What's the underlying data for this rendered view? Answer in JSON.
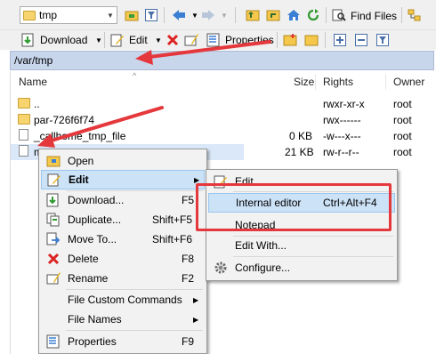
{
  "toolbar1": {
    "path_combo": "tmp",
    "find_files": "Find Files",
    "icons": [
      "folder-open-icon",
      "filter-icon",
      "back-icon",
      "forward-icon",
      "parent-dir-icon",
      "root-dir-icon",
      "home-icon",
      "refresh-icon",
      "find-icon",
      "tree-icon"
    ]
  },
  "toolbar2": {
    "download": "Download",
    "edit": "Edit",
    "properties": "Properties"
  },
  "pathbar": "/var/tmp",
  "columns": {
    "name": "Name",
    "size": "Size",
    "rights": "Rights",
    "owner": "Owner"
  },
  "files": [
    {
      "name": "..",
      "size": "",
      "rights": "rwxr-xr-x",
      "owner": "root"
    },
    {
      "name": "par-726f6f74",
      "size": "",
      "rights": "rwx------",
      "owner": "root"
    },
    {
      "name": "_callhome_tmp_file",
      "size": "0 KB",
      "rights": "-w---x---",
      "owner": "root"
    },
    {
      "name": "m",
      "size": "21 KB",
      "rights": "rw-r--r--",
      "owner": "root"
    }
  ],
  "context_menu": {
    "open": "Open",
    "edit": "Edit",
    "download": "Download...",
    "download_sc": "F5",
    "duplicate": "Duplicate...",
    "duplicate_sc": "Shift+F5",
    "move": "Move To...",
    "move_sc": "Shift+F6",
    "delete": "Delete",
    "delete_sc": "F8",
    "rename": "Rename",
    "rename_sc": "F2",
    "custom": "File Custom Commands",
    "filenames": "File Names",
    "properties": "Properties",
    "properties_sc": "F9"
  },
  "edit_submenu": {
    "edit": "Edit",
    "internal": "Internal editor",
    "internal_sc": "Ctrl+Alt+F4",
    "notepad": "Notepad",
    "edit_with": "Edit With...",
    "configure": "Configure..."
  },
  "colors": {
    "annotation": "#e5383d",
    "selection": "#cce2f7",
    "pathbar": "#c8d6ec"
  }
}
